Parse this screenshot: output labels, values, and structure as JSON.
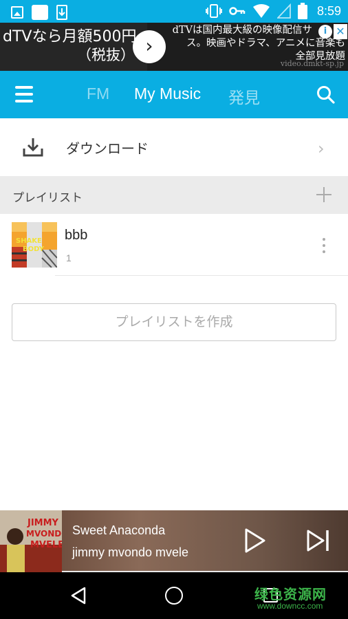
{
  "status_bar": {
    "time": "8:59",
    "left_icons": [
      "image-icon",
      "app-square-icon",
      "download-notification-icon"
    ],
    "right_icons": [
      "vibrate-icon",
      "key-icon",
      "wifi-icon",
      "signal-icon",
      "battery-icon"
    ]
  },
  "ad": {
    "headline": "dTVなら月額500円",
    "headline_sub": "（税抜）",
    "body_lines": [
      "dTVは国内最大級の映像配信サ",
      "ス。映画やドラマ、アニメに音楽も",
      "全部見放題"
    ],
    "domain": "video.dmkt-sp.jp",
    "info_label": "i",
    "close_label": "✕"
  },
  "navbar": {
    "tabs": [
      {
        "label": "FM"
      },
      {
        "label": "My Music"
      },
      {
        "label": "発見"
      }
    ],
    "active_tab": "My Music"
  },
  "download": {
    "label": "ダウンロード"
  },
  "playlist_section": {
    "header": "プレイリスト",
    "items": [
      {
        "name": "bbb",
        "count": "1"
      }
    ],
    "create_label": "プレイリストを作成"
  },
  "player": {
    "title": "Sweet Anaconda",
    "artist": "jimmy mvondo mvele",
    "art_text": "JIMMY MVONDO MVELE"
  },
  "watermark": {
    "text": "绿色资源网",
    "url": "www.downcc.com"
  },
  "colors": {
    "accent": "#0aaee2",
    "header_bg": "#ebebeb"
  }
}
